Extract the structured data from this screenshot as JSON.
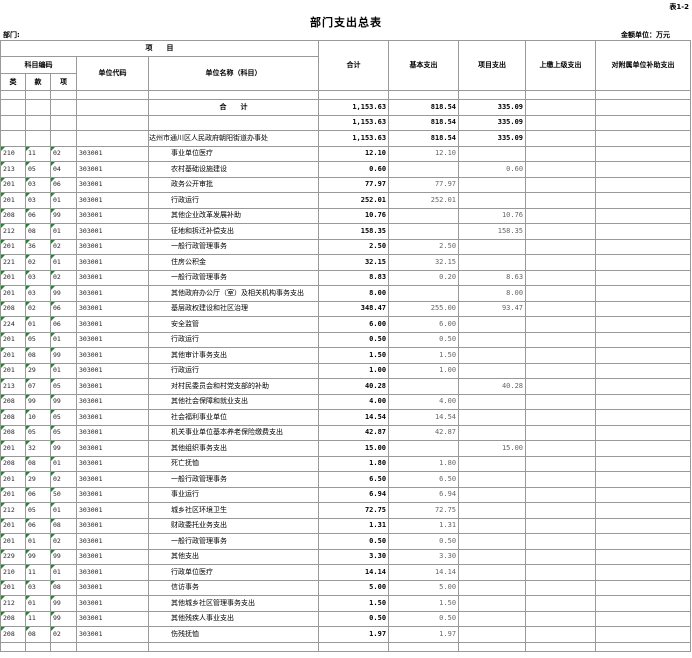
{
  "header": {
    "corner_label": "表1-2",
    "title": "部门支出总表",
    "dept_label": "部门:",
    "unit_label": "金额单位：万元"
  },
  "columns": {
    "item": "项　　目",
    "subject_code": "科目编码",
    "lei": "类",
    "kuan": "款",
    "xiang": "项",
    "unit_code": "单位代码",
    "unit_name": "单位名称（科目）",
    "total": "合计",
    "basic": "基本支出",
    "project": "项目支出",
    "upper": "上缴上级支出",
    "subsidy": "对附属单位补助支出"
  },
  "summary": [
    {
      "lei": "",
      "kuan": "",
      "xiang": "",
      "code": "",
      "name": "合　　计",
      "total": "1,153.63",
      "basic": "818.54",
      "project": "335.09",
      "upper": "",
      "subsidy": ""
    },
    {
      "lei": "",
      "kuan": "",
      "xiang": "",
      "code": "",
      "name": "",
      "total": "1,153.63",
      "basic": "818.54",
      "project": "335.09",
      "upper": "",
      "subsidy": ""
    },
    {
      "lei": "",
      "kuan": "",
      "xiang": "",
      "code": "",
      "name": "达州市通川区人民政府朝阳街道办事处",
      "total": "1,153.63",
      "basic": "818.54",
      "project": "335.09",
      "upper": "",
      "subsidy": ""
    }
  ],
  "rows": [
    {
      "lei": "210",
      "kuan": "11",
      "xiang": "02",
      "code": "303001",
      "name": "事业单位医疗",
      "total": "12.10",
      "basic": "12.10",
      "project": "",
      "upper": "",
      "subsidy": ""
    },
    {
      "lei": "213",
      "kuan": "05",
      "xiang": "04",
      "code": "303001",
      "name": "农村基础设施建设",
      "total": "0.60",
      "basic": "",
      "project": "0.60",
      "upper": "",
      "subsidy": ""
    },
    {
      "lei": "201",
      "kuan": "03",
      "xiang": "06",
      "code": "303001",
      "name": "政务公开审批",
      "total": "77.97",
      "basic": "77.97",
      "project": "",
      "upper": "",
      "subsidy": ""
    },
    {
      "lei": "201",
      "kuan": "03",
      "xiang": "01",
      "code": "303001",
      "name": "行政运行",
      "total": "252.01",
      "basic": "252.01",
      "project": "",
      "upper": "",
      "subsidy": ""
    },
    {
      "lei": "208",
      "kuan": "06",
      "xiang": "99",
      "code": "303001",
      "name": "其他企业改革发展补助",
      "total": "10.76",
      "basic": "",
      "project": "10.76",
      "upper": "",
      "subsidy": ""
    },
    {
      "lei": "212",
      "kuan": "08",
      "xiang": "01",
      "code": "303001",
      "name": "征地和拆迁补偿支出",
      "total": "158.35",
      "basic": "",
      "project": "158.35",
      "upper": "",
      "subsidy": ""
    },
    {
      "lei": "201",
      "kuan": "36",
      "xiang": "02",
      "code": "303001",
      "name": "一般行政管理事务",
      "total": "2.50",
      "basic": "2.50",
      "project": "",
      "upper": "",
      "subsidy": ""
    },
    {
      "lei": "221",
      "kuan": "02",
      "xiang": "01",
      "code": "303001",
      "name": "住房公积金",
      "total": "32.15",
      "basic": "32.15",
      "project": "",
      "upper": "",
      "subsidy": ""
    },
    {
      "lei": "201",
      "kuan": "03",
      "xiang": "02",
      "code": "303001",
      "name": "一般行政管理事务",
      "total": "8.83",
      "basic": "0.20",
      "project": "8.63",
      "upper": "",
      "subsidy": ""
    },
    {
      "lei": "201",
      "kuan": "03",
      "xiang": "99",
      "code": "303001",
      "name": "其他政府办公厅（室）及相关机构事务支出",
      "total": "8.00",
      "basic": "",
      "project": "8.00",
      "upper": "",
      "subsidy": ""
    },
    {
      "lei": "208",
      "kuan": "02",
      "xiang": "06",
      "code": "303001",
      "name": "基层政权建设和社区治理",
      "total": "348.47",
      "basic": "255.00",
      "project": "93.47",
      "upper": "",
      "subsidy": ""
    },
    {
      "lei": "224",
      "kuan": "01",
      "xiang": "06",
      "code": "303001",
      "name": "安全监管",
      "total": "6.00",
      "basic": "6.00",
      "project": "",
      "upper": "",
      "subsidy": ""
    },
    {
      "lei": "201",
      "kuan": "05",
      "xiang": "01",
      "code": "303001",
      "name": "行政运行",
      "total": "0.50",
      "basic": "0.50",
      "project": "",
      "upper": "",
      "subsidy": ""
    },
    {
      "lei": "201",
      "kuan": "08",
      "xiang": "99",
      "code": "303001",
      "name": "其他审计事务支出",
      "total": "1.50",
      "basic": "1.50",
      "project": "",
      "upper": "",
      "subsidy": ""
    },
    {
      "lei": "201",
      "kuan": "29",
      "xiang": "01",
      "code": "303001",
      "name": "行政运行",
      "total": "1.00",
      "basic": "1.00",
      "project": "",
      "upper": "",
      "subsidy": ""
    },
    {
      "lei": "213",
      "kuan": "07",
      "xiang": "05",
      "code": "303001",
      "name": "对村民委员会和村党支部的补助",
      "total": "40.28",
      "basic": "",
      "project": "40.28",
      "upper": "",
      "subsidy": ""
    },
    {
      "lei": "208",
      "kuan": "99",
      "xiang": "99",
      "code": "303001",
      "name": "其他社会保障和就业支出",
      "total": "4.00",
      "basic": "4.00",
      "project": "",
      "upper": "",
      "subsidy": ""
    },
    {
      "lei": "208",
      "kuan": "10",
      "xiang": "05",
      "code": "303001",
      "name": "社会福利事业单位",
      "total": "14.54",
      "basic": "14.54",
      "project": "",
      "upper": "",
      "subsidy": ""
    },
    {
      "lei": "208",
      "kuan": "05",
      "xiang": "05",
      "code": "303001",
      "name": "机关事业单位基本养老保险缴费支出",
      "total": "42.87",
      "basic": "42.87",
      "project": "",
      "upper": "",
      "subsidy": ""
    },
    {
      "lei": "201",
      "kuan": "32",
      "xiang": "99",
      "code": "303001",
      "name": "其他组织事务支出",
      "total": "15.00",
      "basic": "",
      "project": "15.00",
      "upper": "",
      "subsidy": ""
    },
    {
      "lei": "208",
      "kuan": "08",
      "xiang": "01",
      "code": "303001",
      "name": "死亡抚恤",
      "total": "1.80",
      "basic": "1.80",
      "project": "",
      "upper": "",
      "subsidy": ""
    },
    {
      "lei": "201",
      "kuan": "29",
      "xiang": "02",
      "code": "303001",
      "name": "一般行政管理事务",
      "total": "6.50",
      "basic": "6.50",
      "project": "",
      "upper": "",
      "subsidy": ""
    },
    {
      "lei": "201",
      "kuan": "06",
      "xiang": "50",
      "code": "303001",
      "name": "事业运行",
      "total": "6.94",
      "basic": "6.94",
      "project": "",
      "upper": "",
      "subsidy": ""
    },
    {
      "lei": "212",
      "kuan": "05",
      "xiang": "01",
      "code": "303001",
      "name": "城乡社区环境卫生",
      "total": "72.75",
      "basic": "72.75",
      "project": "",
      "upper": "",
      "subsidy": ""
    },
    {
      "lei": "201",
      "kuan": "06",
      "xiang": "08",
      "code": "303001",
      "name": "财政委托业务支出",
      "total": "1.31",
      "basic": "1.31",
      "project": "",
      "upper": "",
      "subsidy": ""
    },
    {
      "lei": "201",
      "kuan": "01",
      "xiang": "02",
      "code": "303001",
      "name": "一般行政管理事务",
      "total": "0.50",
      "basic": "0.50",
      "project": "",
      "upper": "",
      "subsidy": ""
    },
    {
      "lei": "229",
      "kuan": "99",
      "xiang": "99",
      "code": "303001",
      "name": "其他支出",
      "total": "3.30",
      "basic": "3.30",
      "project": "",
      "upper": "",
      "subsidy": ""
    },
    {
      "lei": "210",
      "kuan": "11",
      "xiang": "01",
      "code": "303001",
      "name": "行政单位医疗",
      "total": "14.14",
      "basic": "14.14",
      "project": "",
      "upper": "",
      "subsidy": ""
    },
    {
      "lei": "201",
      "kuan": "03",
      "xiang": "08",
      "code": "303001",
      "name": "信访事务",
      "total": "5.00",
      "basic": "5.00",
      "project": "",
      "upper": "",
      "subsidy": ""
    },
    {
      "lei": "212",
      "kuan": "01",
      "xiang": "99",
      "code": "303001",
      "name": "其他城乡社区管理事务支出",
      "total": "1.50",
      "basic": "1.50",
      "project": "",
      "upper": "",
      "subsidy": ""
    },
    {
      "lei": "208",
      "kuan": "11",
      "xiang": "99",
      "code": "303001",
      "name": "其他残疾人事业支出",
      "total": "0.50",
      "basic": "0.50",
      "project": "",
      "upper": "",
      "subsidy": ""
    },
    {
      "lei": "208",
      "kuan": "08",
      "xiang": "02",
      "code": "303001",
      "name": "伤残抚恤",
      "total": "1.97",
      "basic": "1.97",
      "project": "",
      "upper": "",
      "subsidy": ""
    }
  ]
}
